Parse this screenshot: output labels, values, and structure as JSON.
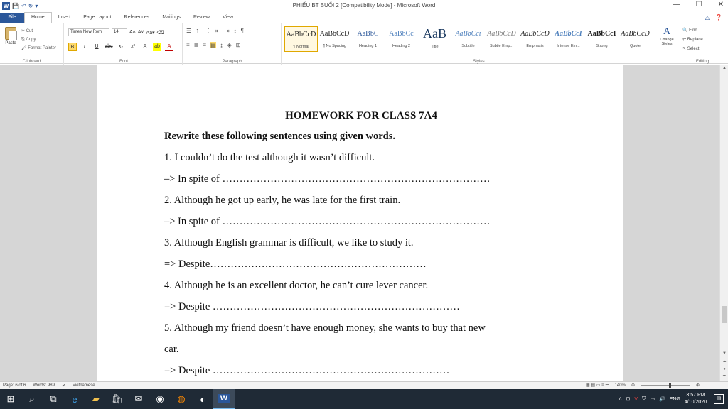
{
  "window": {
    "title": "PHIẾU BT BUỔI 2 [Compatibility Mode] - Microsoft Word",
    "minimize": "—",
    "maximize": "☐",
    "close": "✕"
  },
  "tabs": [
    "File",
    "Home",
    "Insert",
    "Page Layout",
    "References",
    "Mailings",
    "Review",
    "View"
  ],
  "active_tab": "Home",
  "ribbon": {
    "clipboard": {
      "paste": "Paste",
      "cut": "Cut",
      "copy": "Copy",
      "format_painter": "Format Painter",
      "label": "Clipboard"
    },
    "font": {
      "name": "Times New Rom",
      "size": "14",
      "label": "Font"
    },
    "paragraph": {
      "label": "Paragraph"
    },
    "styles": {
      "label": "Styles",
      "items": [
        {
          "sample": "AaBbCcD",
          "name": "¶ Normal"
        },
        {
          "sample": "AaBbCcD",
          "name": "¶ No Spacing"
        },
        {
          "sample": "AaBbC",
          "name": "Heading 1"
        },
        {
          "sample": "AaBbCc",
          "name": "Heading 2"
        },
        {
          "sample": "AaB",
          "name": "Title"
        },
        {
          "sample": "AaBbCcı",
          "name": "Subtitle"
        },
        {
          "sample": "AaBbCcD",
          "name": "Subtle Emp..."
        },
        {
          "sample": "AaBbCcD",
          "name": "Emphasis"
        },
        {
          "sample": "AaBbCcI",
          "name": "Intense Em..."
        },
        {
          "sample": "AaBbCcI",
          "name": "Strong"
        },
        {
          "sample": "AaBbCcD",
          "name": "Quote"
        }
      ],
      "change_styles": "Change Styles"
    },
    "editing": {
      "find": "Find",
      "replace": "Replace",
      "select": "Select",
      "label": "Editing"
    }
  },
  "document": {
    "title": "HOMEWORK FOR CLASS 7A4",
    "instruction": "Rewrite these following sentences using given words.",
    "lines": [
      "1.  I couldn’t do the test although it wasn’t difficult.",
      "–> In spite of ……………………………………………………………………",
      "2.  Although he got up early, he was late for the first train.",
      "–> In spite of ……………………………………………………………………",
      "3. Although English grammar is difficult, we like to study it.",
      " => Despite………………………………………………………",
      "4. Although he is an excellent doctor, he can’t cure lever cancer.",
      "=> Despite ………………………………………………………………",
      "5. Although my friend doesn’t have enough money, she wants to buy that new",
      "car.",
      "=> Despite ……………………………………………………………"
    ]
  },
  "status": {
    "page": "Page: 6 of 6",
    "words": "Words: 989",
    "language": "Vietnamese",
    "zoom": "140%"
  },
  "taskbar": {
    "language": "ENG",
    "time": "3:57 PM",
    "date": "4/10/2020"
  }
}
